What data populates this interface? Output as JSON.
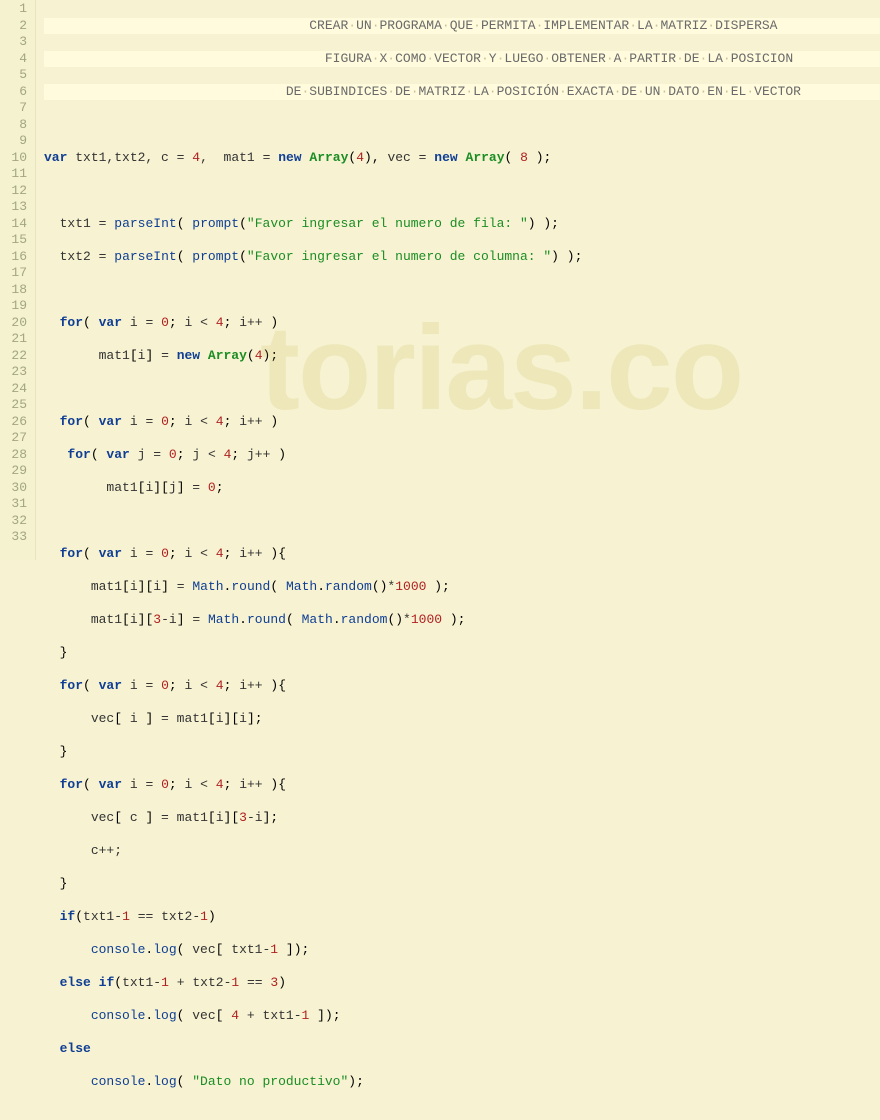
{
  "watermark": "torias.co",
  "gutter": [
    "1",
    "2",
    "3",
    "4",
    "5",
    "6",
    "7",
    "8",
    "9",
    "10",
    "11",
    "12",
    "13",
    "14",
    "15",
    "16",
    "17",
    "18",
    "19",
    "20",
    "21",
    "22",
    "23",
    "24",
    "25",
    "26",
    "27",
    "28",
    "29",
    "30",
    "31",
    "32",
    "33"
  ],
  "chart_data": {
    "type": "table",
    "title": "JavaScript code listing",
    "lines": [
      "                                  CREAR UN PROGRAMA QUE PERMITA IMPLEMENTAR LA MATRIZ DISPERSA",
      "                                    FIGURA X COMO VECTOR Y LUEGO OBTENER A PARTIR DE LA POSICION",
      "                               DE SUBINDICES DE MATRIZ LA POSICIÓN EXACTA DE UN DATO EN EL VECTOR",
      "",
      "var txt1,txt2, c = 4,  mat1 = new Array(4), vec = new Array( 8 );",
      "",
      "  txt1 = parseInt( prompt(\"Favor ingresar el numero de fila: \") );",
      "  txt2 = parseInt( prompt(\"Favor ingresar el numero de columna: \") );",
      "",
      "  for( var i = 0; i < 4; i++ )",
      "       mat1[i] = new Array(4);",
      "",
      "  for( var i = 0; i < 4; i++ )",
      "   for( var j = 0; j < 4; j++ )",
      "        mat1[i][j] = 0;",
      "",
      "  for( var i = 0; i < 4; i++ ){",
      "      mat1[i][i] = Math.round( Math.random()*1000 );",
      "      mat1[i][3-i] = Math.round( Math.random()*1000 );",
      "  }",
      "  for( var i = 0; i < 4; i++ ){",
      "      vec[ i ] = mat1[i][i];",
      "  }",
      "  for( var i = 0; i < 4; i++ ){",
      "      vec[ c ] = mat1[i][3-i];",
      "      c++;",
      "  }",
      "  if(txt1-1 == txt2-1)",
      "      console.log( vec[ txt1-1 ]);",
      "  else if(txt1-1 + txt2-1 == 3)",
      "      console.log( vec[ 4 + txt1-1 ]);",
      "  else",
      "      console.log( \"Dato no productivo\");"
    ]
  },
  "c1": "CREAR·UN·PROGRAMA·QUE·PERMITA·IMPLEMENTAR·LA·MATRIZ·DISPERSA",
  "c2": "FIGURA·X·COMO·VECTOR·Y·LUEGO·OBTENER·A·PARTIR·DE·LA·POSICION",
  "c3": "DE·SUBINDICES·DE·MATRIZ·LA·POSICIÓN·EXACTA·DE·UN·DATO·EN·EL·VECTOR",
  "t": {
    "var": "var",
    "new": "new",
    "for": "for",
    "if": "if",
    "else": "else",
    "txt12": "txt1,txt2,",
    "c": "c",
    "eq": "=",
    "n4": "4",
    "n0": "0",
    "n3": "3",
    "n8": "8",
    "n1": "1",
    "n1000": "1000",
    "mat1": "mat1",
    "vec": "vec",
    "Array": "Array",
    "i": "i",
    "j": "j",
    "txt1": "txt1",
    "txt2": "txt2",
    "parseInt": "parseInt",
    "prompt": "prompt",
    "str_fila": "\"Favor ingresar el numero de fila: \"",
    "str_col": "\"Favor ingresar el numero de columna: \"",
    "inc": "i++",
    "jnc": "j++",
    "cpp": "c++;",
    "Math": "Math",
    "round": "round",
    "random": "random",
    "console": "console",
    "log": "log",
    "str_dato": "\"Dato no productivo\"",
    "lt": "<",
    "plus": "+",
    "minus": "-",
    "eqeq": "==",
    "mul": "*"
  }
}
